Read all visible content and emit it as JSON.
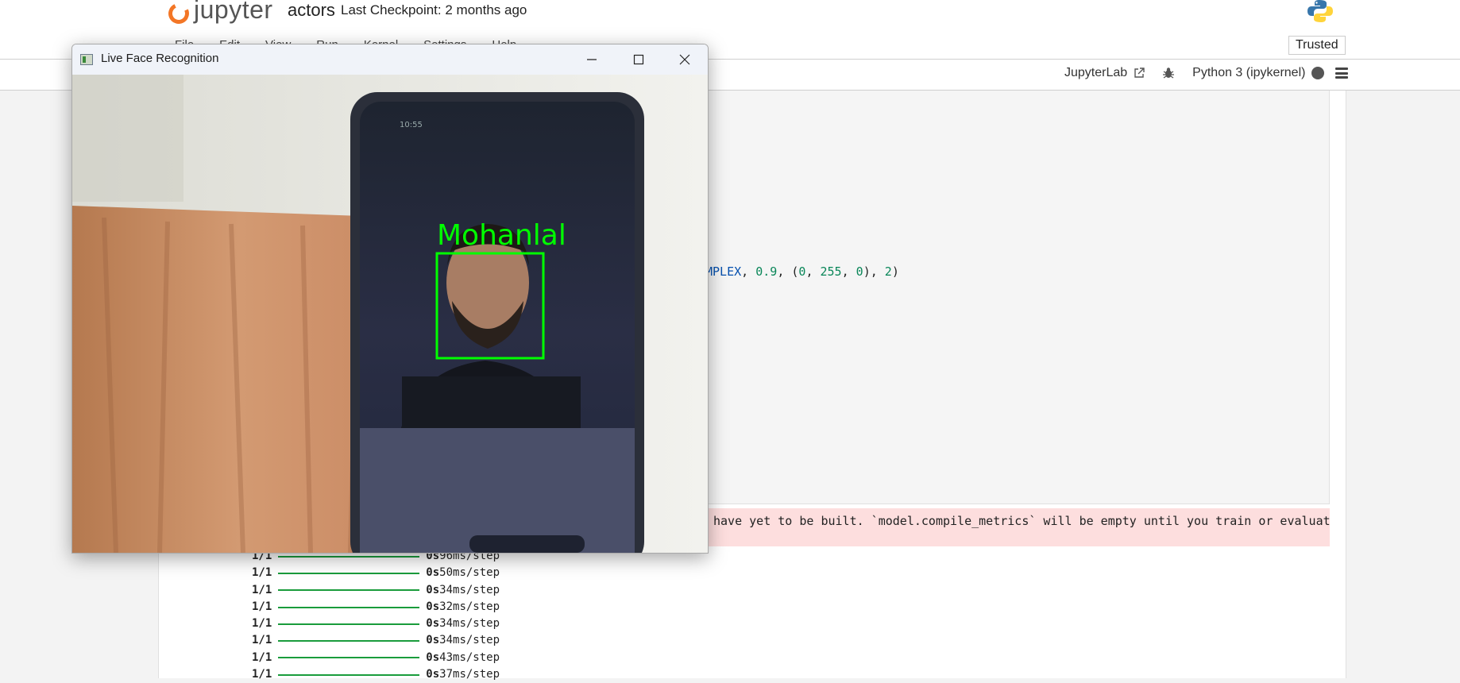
{
  "header": {
    "logo_text": "jupyter",
    "notebook_name": "actors",
    "checkpoint": "Last Checkpoint: 2 months ago"
  },
  "menu": {
    "items": [
      "File",
      "Edit",
      "View",
      "Run",
      "Kernel",
      "Settings",
      "Help"
    ],
    "trusted_label": "Trusted"
  },
  "toolbar": {
    "jupyterlab_label": "JupyterLab",
    "kernel_label": "Python 3 (ipykernel)"
  },
  "code": {
    "line_fragment": {
      "p1": "MPLEX",
      "p2": ", ",
      "p3": "0.9",
      "p4": ", (",
      "p5": "0",
      "p6": ", ",
      "p7": "255",
      "p8": ", ",
      "p9": "0",
      "p10": "), ",
      "p11": "2",
      "p12": ")"
    }
  },
  "output": {
    "warning_text": "have yet to be built. `model.compile_metrics` will be empty until you train or evaluat",
    "steps": [
      {
        "count": "1/1",
        "time": "0s",
        "rate": "96ms/step"
      },
      {
        "count": "1/1",
        "time": "0s",
        "rate": "50ms/step"
      },
      {
        "count": "1/1",
        "time": "0s",
        "rate": "34ms/step"
      },
      {
        "count": "1/1",
        "time": "0s",
        "rate": "32ms/step"
      },
      {
        "count": "1/1",
        "time": "0s",
        "rate": "34ms/step"
      },
      {
        "count": "1/1",
        "time": "0s",
        "rate": "34ms/step"
      },
      {
        "count": "1/1",
        "time": "0s",
        "rate": "43ms/step"
      },
      {
        "count": "1/1",
        "time": "0s",
        "rate": "37ms/step"
      }
    ]
  },
  "cv_window": {
    "title": "Live Face Recognition",
    "detected_label": "Mohanlal",
    "phone_status_time": "10:55",
    "box_color": "#00ff00"
  },
  "colors": {
    "jupyter_orange": "#f37626",
    "error_background": "#fddede",
    "progress_green": "#1a9c3c"
  }
}
